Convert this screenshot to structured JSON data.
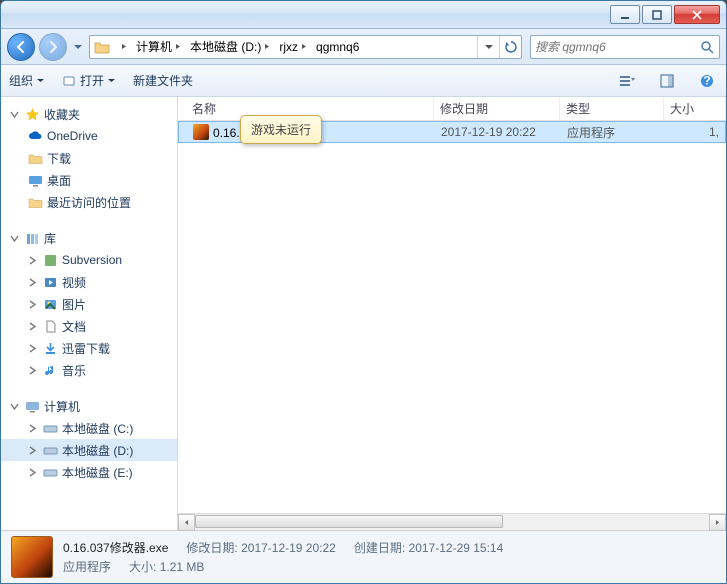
{
  "breadcrumbs": [
    "计算机",
    "本地磁盘 (D:)",
    "rjxz",
    "qgmnq6"
  ],
  "search": {
    "placeholder": "搜索 qgmnq6"
  },
  "toolbar": {
    "organize": "组织",
    "open": "打开",
    "newfolder": "新建文件夹"
  },
  "columns": {
    "name": "名称",
    "date": "修改日期",
    "type": "类型",
    "size": "大小"
  },
  "tree": {
    "favorites": "收藏夹",
    "onedrive": "OneDrive",
    "downloads": "下载",
    "desktop": "桌面",
    "recent": "最近访问的位置",
    "libraries": "库",
    "subversion": "Subversion",
    "videos": "视频",
    "pictures": "图片",
    "documents": "文档",
    "xunlei": "迅雷下载",
    "music": "音乐",
    "computer": "计算机",
    "drive_c": "本地磁盘 (C:)",
    "drive_d": "本地磁盘 (D:)",
    "drive_e": "本地磁盘 (E:)"
  },
  "file": {
    "name": "0.16.037修改器.exe",
    "date": "2017-12-19 20:22",
    "type": "应用程序",
    "size": "1,"
  },
  "tooltip": "游戏未运行",
  "details": {
    "name": "0.16.037修改器.exe",
    "type": "应用程序",
    "modlabel": "修改日期:",
    "moddate": "2017-12-19 20:22",
    "createlabel": "创建日期:",
    "createdate": "2017-12-29 15:14",
    "sizelabel": "大小:",
    "size": "1.21 MB"
  }
}
